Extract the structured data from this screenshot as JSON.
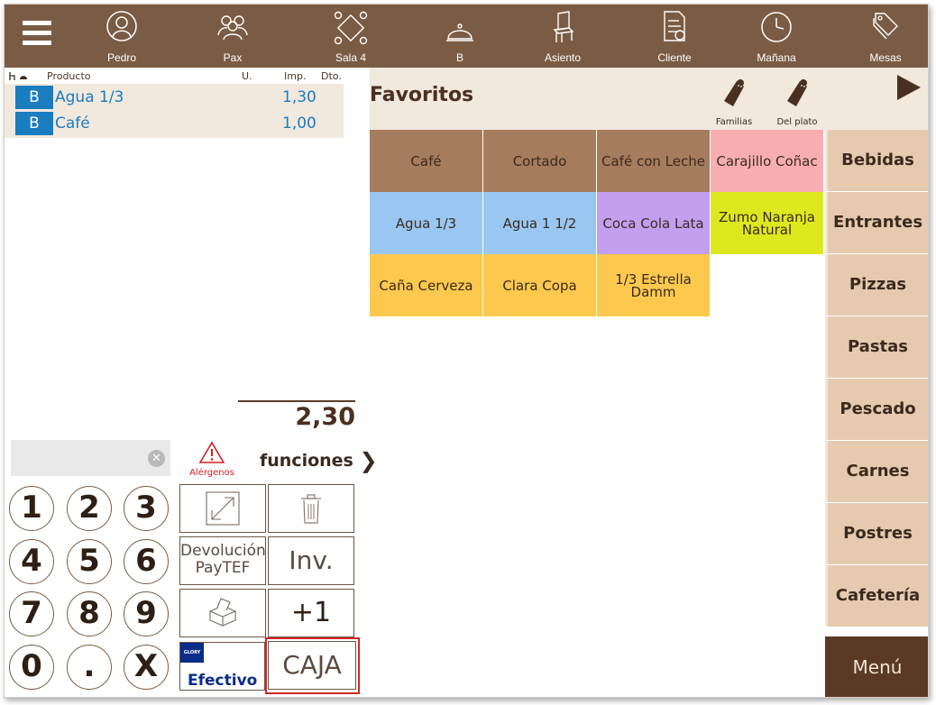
{
  "topbar": {
    "items": [
      {
        "label": "Pedro",
        "icon": "user-icon"
      },
      {
        "label": "Pax",
        "icon": "group-icon"
      },
      {
        "label": "Sala 4",
        "icon": "table-layout-icon"
      },
      {
        "label": "B",
        "icon": "cloche-icon"
      },
      {
        "label": "Asiento",
        "icon": "chair-icon"
      },
      {
        "label": "Cliente",
        "icon": "client-document-icon"
      },
      {
        "label": "Mañana",
        "icon": "clock-icon"
      },
      {
        "label": "Mesas",
        "icon": "tags-icon"
      }
    ]
  },
  "ticket": {
    "columns": {
      "product": "Producto",
      "units": "U.",
      "amount": "Imp.",
      "discount": "Dto."
    },
    "lines": [
      {
        "badge": "B",
        "name": "Agua 1/3",
        "price": "1,30"
      },
      {
        "badge": "B",
        "name": "Café",
        "price": "1,00"
      }
    ],
    "total": "2,30"
  },
  "tools": {
    "allergens_label": "Alérgenos",
    "functions_label": "funciones",
    "functions_chevron": "❯",
    "clear_glyph": "✕"
  },
  "keypad": [
    "1",
    "2",
    "3",
    "4",
    "5",
    "6",
    "7",
    "8",
    "9",
    "0",
    ".",
    "X"
  ],
  "function_buttons": {
    "refund_line1": "Devolución",
    "refund_line2": "PayTEF",
    "inv": "Inv.",
    "plus_one": "+1",
    "cash_logo": "GLORY",
    "cash": "Efectivo",
    "caja": "CAJA"
  },
  "favorites": {
    "title": "Favoritos",
    "families_label": "Familias",
    "del_plato_label": "Del plato",
    "tiles": [
      {
        "label": "Café",
        "color": "#a67c5e"
      },
      {
        "label": "Cortado",
        "color": "#a67c5e"
      },
      {
        "label": "Café con Leche",
        "color": "#a67c5e"
      },
      {
        "label": "Carajillo Coñac",
        "color": "#f8aeb0"
      },
      {
        "label": "Agua 1/3",
        "color": "#99c7f2"
      },
      {
        "label": "Agua 1 1/2",
        "color": "#99c7f2"
      },
      {
        "label": "Coca Cola Lata",
        "color": "#c49ef0"
      },
      {
        "label": "Zumo Naranja Natural",
        "color": "#dde81e"
      },
      {
        "label": "Caña Cerveza",
        "color": "#fcc94e"
      },
      {
        "label": "Clara Copa",
        "color": "#fcc94e"
      },
      {
        "label": "1/3 Estrella Damm",
        "color": "#fcc94e"
      }
    ]
  },
  "categories": [
    "Bebidas",
    "Entrantes",
    "Pizzas",
    "Pastas",
    "Pescado",
    "Carnes",
    "Postres",
    "Cafetería"
  ],
  "menu_label": "Menú"
}
